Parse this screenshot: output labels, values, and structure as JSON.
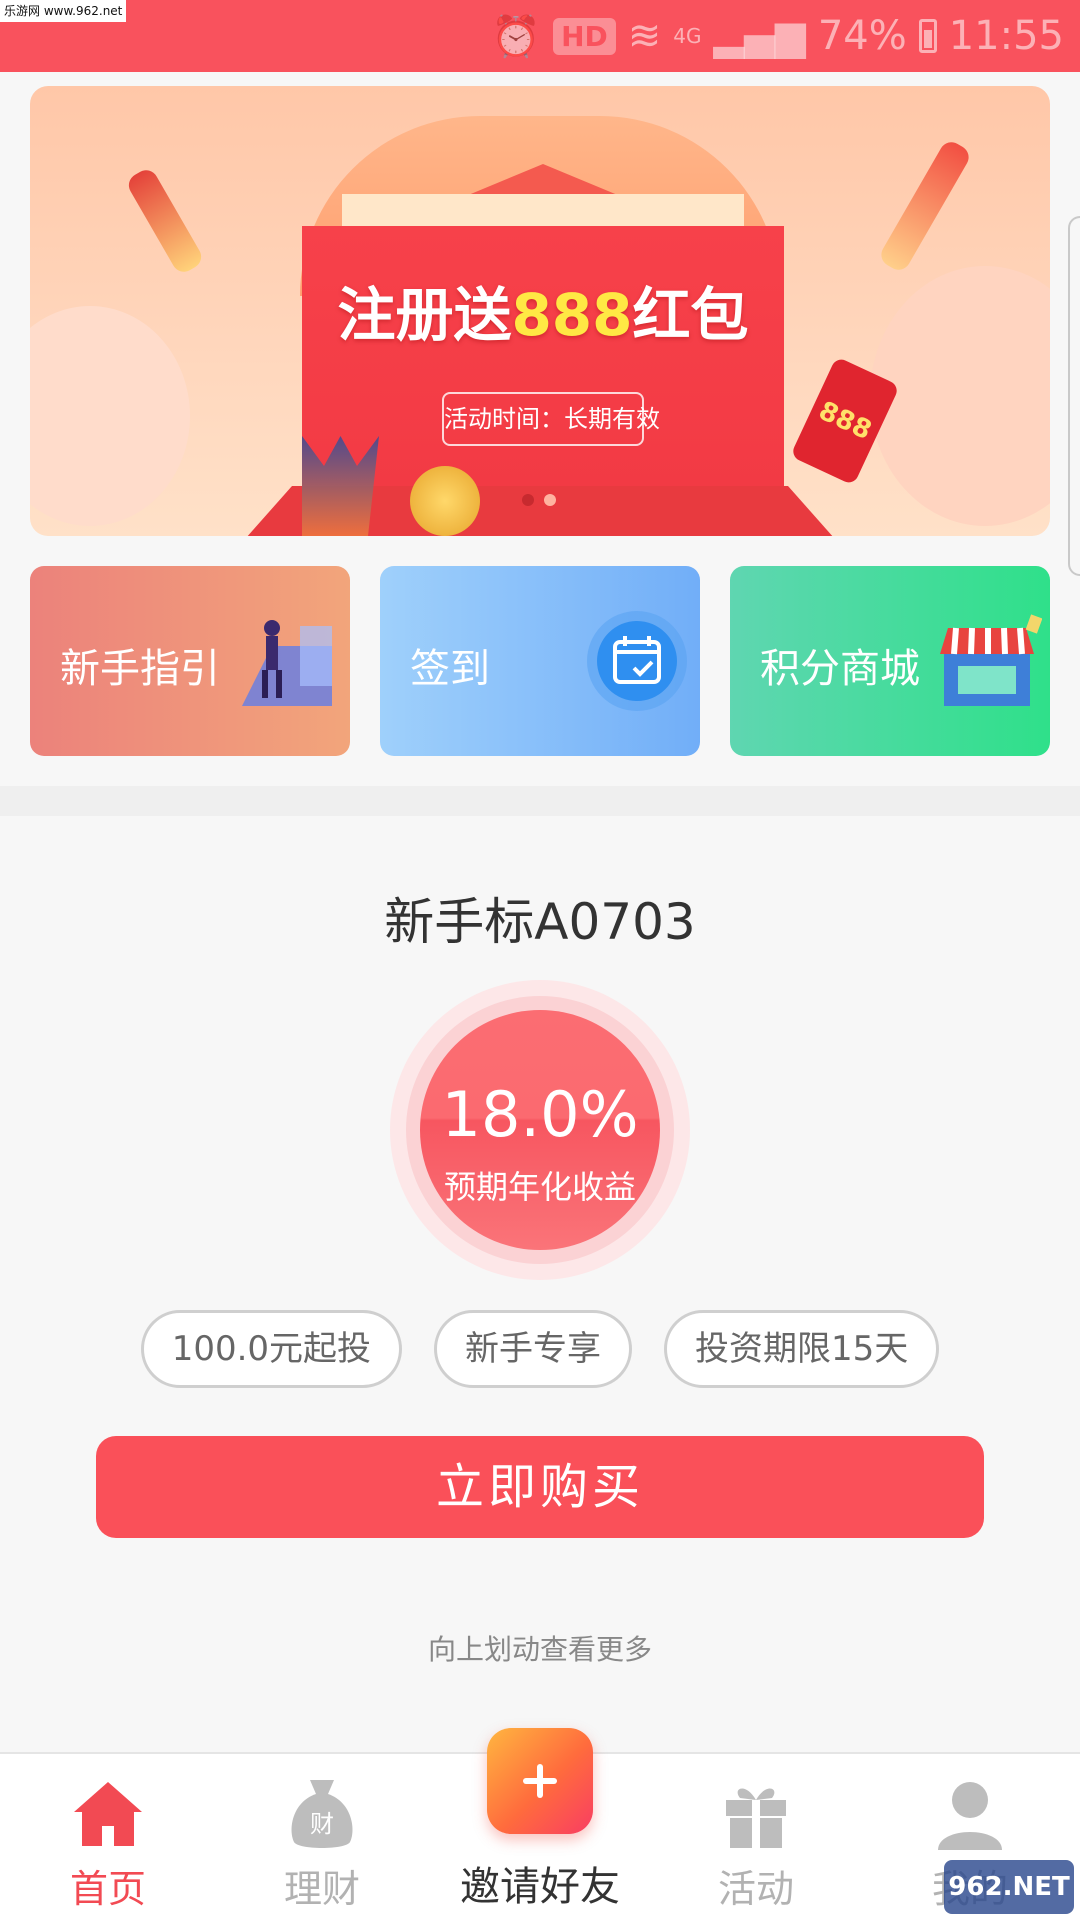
{
  "statusbar": {
    "watermark": "乐游网 www.962.net",
    "hd": "HD",
    "network": "4G",
    "battery": "74%",
    "time": "11:55"
  },
  "banner": {
    "headline_prefix": "注册送",
    "headline_number": "888",
    "headline_suffix": "红包",
    "period": "活动时间：长期有效",
    "tag": "888",
    "active_slide": 1,
    "slides": 2
  },
  "features": [
    {
      "label": "新手指引",
      "icon": "guide-illustration"
    },
    {
      "label": "签到",
      "icon": "calendar-check-icon"
    },
    {
      "label": "积分商城",
      "icon": "shop-icon"
    }
  ],
  "product": {
    "title": "新手标A0703",
    "rate": "18.0%",
    "rate_label": "预期年化收益",
    "tags": [
      "100.0元起投",
      "新手专享",
      "投资期限15天"
    ],
    "buy_label": "立即购买",
    "more_hint": "向上划动查看更多"
  },
  "nav": {
    "items": [
      {
        "label": "首页",
        "icon": "home-icon",
        "active": true
      },
      {
        "label": "理财",
        "icon": "money-bag-icon",
        "active": false
      },
      {
        "label": "邀请好友",
        "icon": "plus-icon",
        "active": false
      },
      {
        "label": "活动",
        "icon": "gift-icon",
        "active": false
      },
      {
        "label": "我的",
        "icon": "user-icon",
        "active": false
      }
    ]
  },
  "watermark_bottom": "962.NET",
  "colors": {
    "accent": "#f9525d",
    "button": "#fa5059",
    "nav_active": "#f24a53"
  }
}
